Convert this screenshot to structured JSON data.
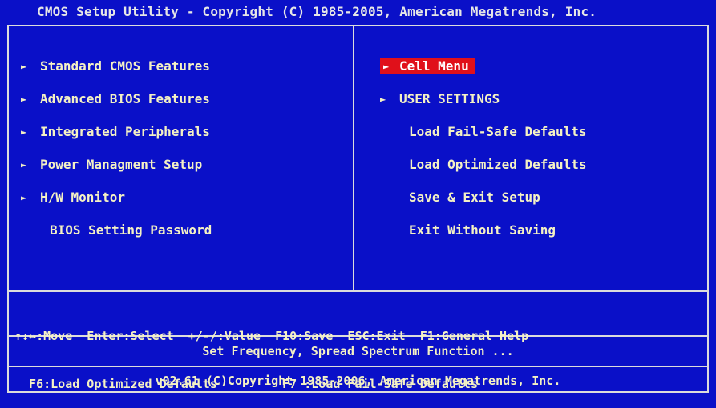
{
  "window": {
    "title": "CMOS Setup Utility - Copyright (C) 1985-2005, American Megatrends, Inc."
  },
  "left_menu": [
    {
      "label": "Standard CMOS Features",
      "submenu": true
    },
    {
      "label": "Advanced BIOS Features",
      "submenu": true
    },
    {
      "label": "Integrated Peripherals",
      "submenu": true
    },
    {
      "label": "Power Managment Setup",
      "submenu": true
    },
    {
      "label": "H/W Monitor",
      "submenu": true
    },
    {
      "label": "BIOS Setting Password",
      "submenu": false
    }
  ],
  "right_menu": [
    {
      "label": "Cell Menu",
      "submenu": true,
      "selected": true
    },
    {
      "label": "USER SETTINGS",
      "submenu": true
    },
    {
      "label": "Load Fail-Safe Defaults",
      "submenu": false
    },
    {
      "label": "Load Optimized Defaults",
      "submenu": false
    },
    {
      "label": "Save & Exit Setup",
      "submenu": false
    },
    {
      "label": "Exit Without Saving",
      "submenu": false
    }
  ],
  "icons": {
    "submenu_arrow": "►"
  },
  "keys": {
    "line1": "↑↓↔:Move  Enter:Select  +/-/:Value  F10:Save  ESC:Exit  F1:General Help",
    "line2": "  F6:Load Optimized Defaults         F7 :Load Fail-Safe Defaults"
  },
  "description": "Set Frequency, Spread Spectrum Function ...",
  "footer": "v02.61 (C)Copyright 1985-2006, American Megatrends, Inc.",
  "colors": {
    "background": "#0a10c8",
    "text": "#f4f1c4",
    "highlight": "#e0101a",
    "border": "#dcdcdc"
  }
}
